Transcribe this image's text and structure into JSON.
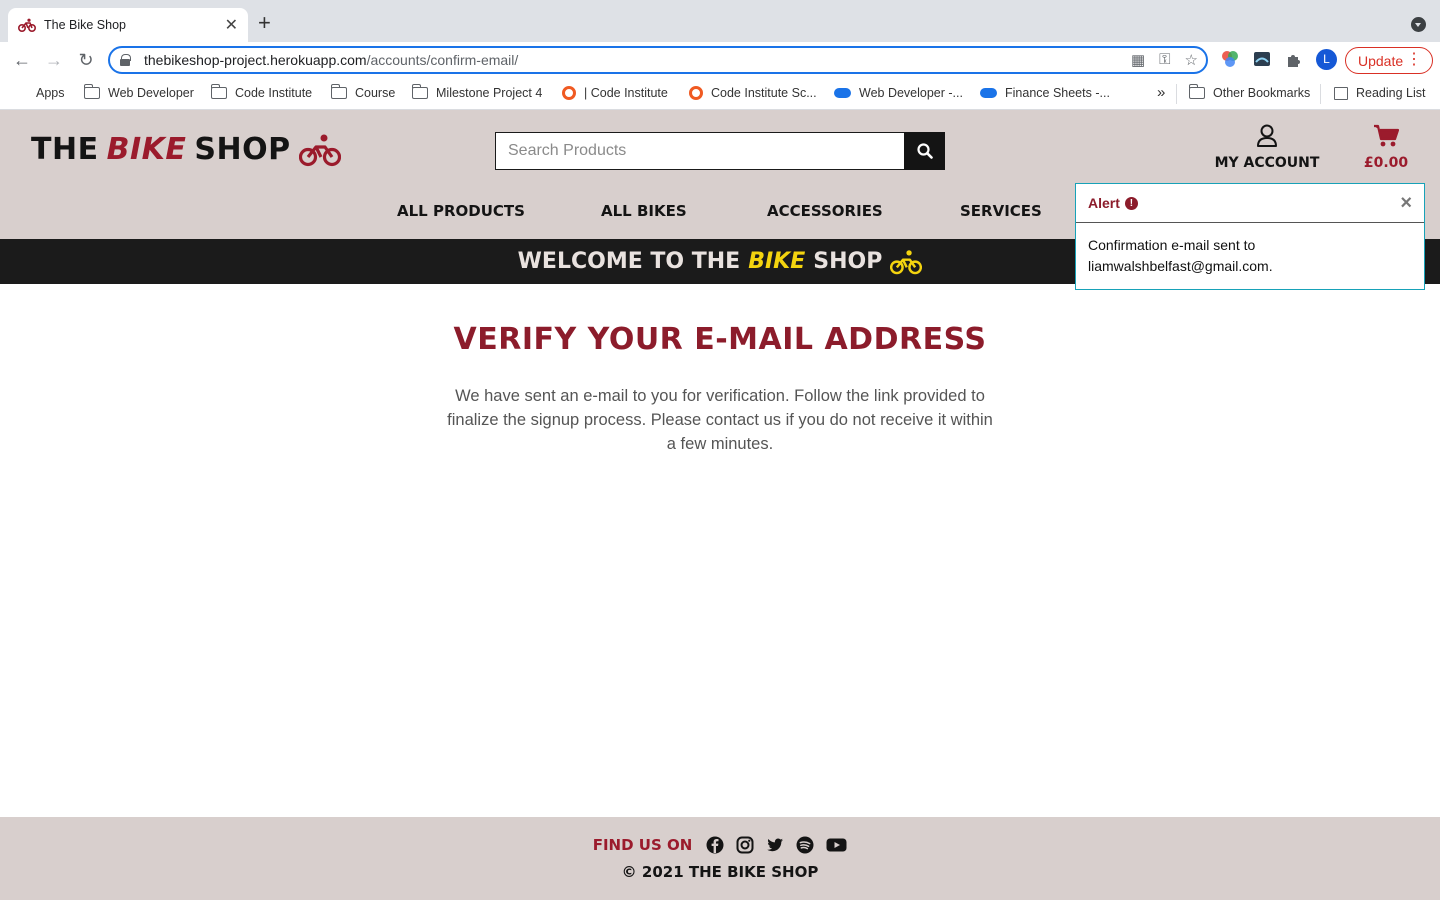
{
  "browser": {
    "tab_title": "The Bike Shop",
    "url_host": "thebikeshop-project.herokuapp.com",
    "url_path": "/accounts/confirm-email/",
    "profile_initial": "L",
    "update_label": "Update",
    "bookmarks": [
      "Apps",
      "Web Developer",
      "Code Institute",
      "Course",
      "Milestone Project 4",
      "| Code Institute",
      "Code Institute Sc...",
      "Web Developer -...",
      "Finance Sheets -..."
    ],
    "overflow_label": "»",
    "other_bookmarks": "Other Bookmarks",
    "reading_list": "Reading List"
  },
  "header": {
    "logo_the": "THE",
    "logo_bike": "BIKE",
    "logo_shop": "SHOP",
    "search_placeholder": "Search Products",
    "account_label": "MY ACCOUNT",
    "basket_total": "£0.00"
  },
  "nav": [
    "ALL PRODUCTS",
    "ALL BIKES",
    "ACCESSORIES",
    "SERVICES"
  ],
  "banner": {
    "welcome": "WELCOME TO THE",
    "bike": "BIKE",
    "shop": "SHOP"
  },
  "main": {
    "title": "VERIFY YOUR E-MAIL ADDRESS",
    "body": "We have sent an e-mail to you for verification. Follow the link provided to finalize the signup process. Please contact us if you do not receive it within a few minutes."
  },
  "alert": {
    "title": "Alert",
    "message": "Confirmation e-mail sent to liamwalshbelfast@gmail.com."
  },
  "footer": {
    "find_us": "FIND US ON",
    "social_icons": [
      "facebook-icon",
      "instagram-icon",
      "twitter-icon",
      "spotify-icon",
      "youtube-icon"
    ],
    "copyright": "© 2021 THE BIKE SHOP"
  },
  "colors": {
    "brand_red": "#9b1b2c",
    "brand_yellow": "#f4d40f",
    "header_bg": "#d8cfcd",
    "banner_bg": "#1b1b1b",
    "alert_border": "#17a2b8"
  }
}
